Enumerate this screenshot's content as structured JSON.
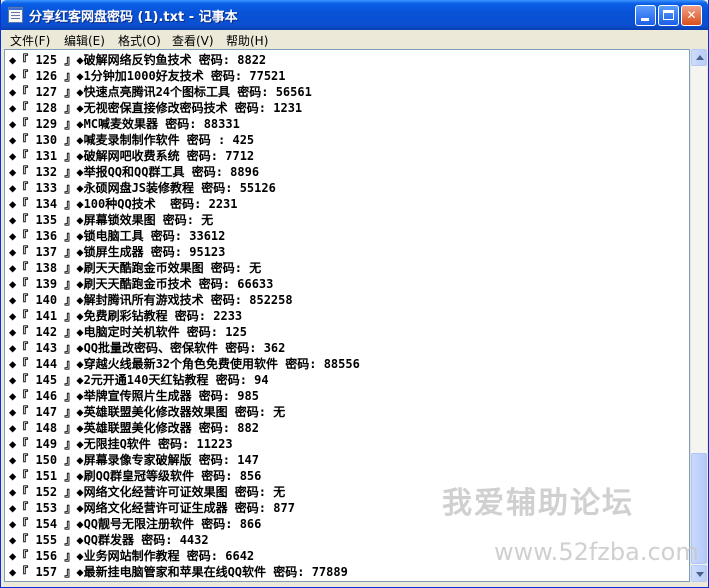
{
  "window": {
    "title": "分享红客网盘密码 (1).txt - 记事本",
    "controls": {
      "minimize": "",
      "maximize": "",
      "close": "✕"
    }
  },
  "menu": [
    {
      "label": "文件(F)"
    },
    {
      "label": "编辑(E)"
    },
    {
      "label": "格式(O)"
    },
    {
      "label": "查看(V)"
    },
    {
      "label": "帮助(H)"
    }
  ],
  "lines": [
    "◆『 125 』◆破解网络反钓鱼技术 密码: 8822",
    "◆『 126 』◆1分钟加1000好友技术 密码: 77521",
    "◆『 127 』◆快速点亮腾讯24个图标工具 密码: 56561",
    "◆『 128 』◆无视密保直接修改密码技术 密码: 1231",
    "◆『 129 』◆MC喊麦效果器 密码: 88331",
    "◆『 130 』◆喊麦录制制作软件 密码 : 425",
    "◆『 131 』◆破解网吧收费系统 密码: 7712",
    "◆『 132 』◆举报QQ和QQ群工具 密码: 8896",
    "◆『 133 』◆永硕网盘JS装修教程 密码: 55126",
    "◆『 134 』◆100种QQ技术  密码: 2231",
    "◆『 135 』◆屏幕锁效果图 密码: 无",
    "◆『 136 』◆锁电脑工具 密码: 33612",
    "◆『 137 』◆锁屏生成器 密码: 95123",
    "◆『 138 』◆刷天天酷跑金币效果图 密码: 无",
    "◆『 139 』◆刷天天酷跑金币技术 密码: 66633",
    "◆『 140 』◆解封腾讯所有游戏技术 密码: 852258",
    "◆『 141 』◆免费刷彩钻教程 密码: 2233",
    "◆『 142 』◆电脑定时关机软件 密码: 125",
    "◆『 143 』◆QQ批量改密码、密保软件 密码: 362",
    "◆『 144 』◆穿越火线最新32个角色免费使用软件 密码: 88556",
    "◆『 145 』◆2元开通140天红钻教程 密码: 94",
    "◆『 146 』◆举牌宣传照片生成器 密码: 985",
    "◆『 147 』◆英雄联盟美化修改器效果图 密码: 无",
    "◆『 148 』◆英雄联盟美化修改器 密码: 882",
    "◆『 149 』◆无限挂Q软件 密码: 11223",
    "◆『 150 』◆屏幕录像专家破解版 密码: 147",
    "◆『 151 』◆刷QQ群皇冠等级软件 密码: 856",
    "◆『 152 』◆网络文化经营许可证效果图 密码: 无",
    "◆『 153 』◆网络文化经营许可证生成器 密码: 877",
    "◆『 154 』◆QQ靓号无限注册软件 密码: 866",
    "◆『 155 』◆QQ群发器 密码: 4432",
    "◆『 156 』◆业务网站制作教程 密码: 6642",
    "◆『 157 』◆最新挂电脑管家和苹果在线QQ软件 密码: 77889"
  ],
  "watermark": {
    "text": "我爱辅助论坛",
    "url": "www.52fzba.com"
  }
}
